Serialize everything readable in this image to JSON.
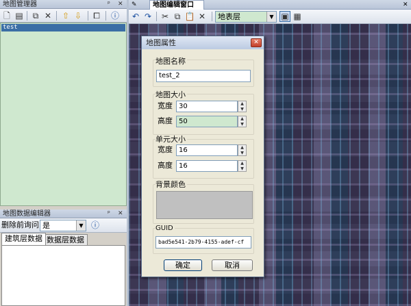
{
  "left_panel": {
    "title": "地图管理器",
    "pin": "📌",
    "close": "✕",
    "items": [
      "test"
    ]
  },
  "data_editor": {
    "title": "地图数据编辑器",
    "pin": "📌",
    "close": "✕",
    "delete_prompt_label": "删除前询问",
    "delete_prompt_value": "是",
    "tabs": [
      "建筑层数据",
      "数据层数据"
    ]
  },
  "editor": {
    "tab_title": "地图编辑窗口",
    "tab_close": "✕",
    "layer_select": "地表层"
  },
  "dialog": {
    "title": "地图属性",
    "close": "✕",
    "map_name_label": "地图名称",
    "map_name": "test_2",
    "map_size_label": "地图大小",
    "width_label": "宽度",
    "map_width": "30",
    "height_label": "高度",
    "map_height": "50",
    "cell_size_label": "单元大小",
    "cell_width": "16",
    "cell_height": "16",
    "bg_color_label": "背景颜色",
    "bg_color": "#c0c0c0",
    "guid_label": "GUID",
    "guid": "bad5e541-2b79-4155-adef-cf",
    "ok": "确定",
    "cancel": "取消"
  },
  "colors": {
    "tree_bg": "#cfe8cf",
    "selection": "#3a6ea5",
    "dialog_bg": "#ece9d8"
  }
}
